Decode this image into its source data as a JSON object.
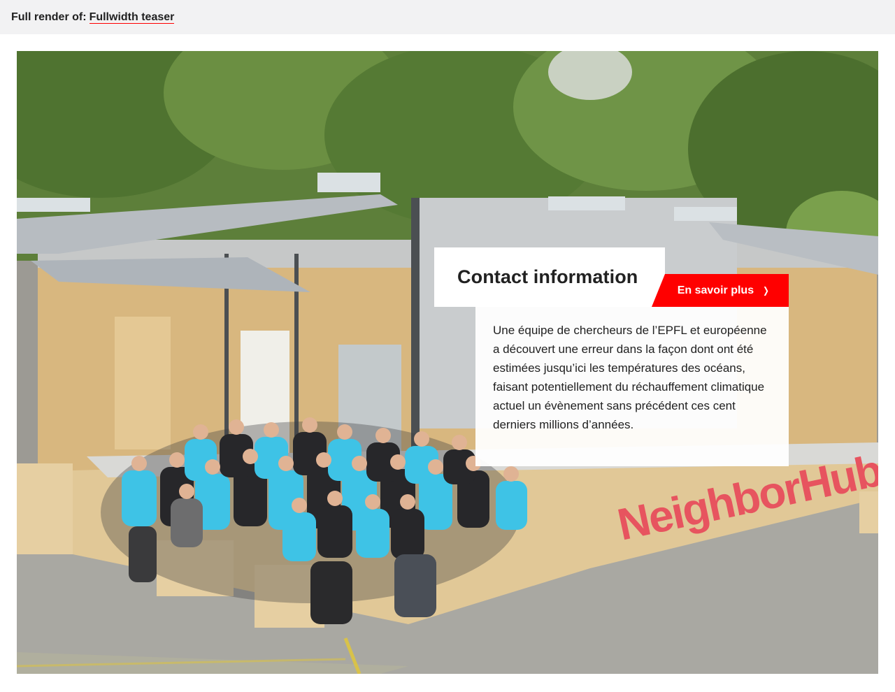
{
  "topbar": {
    "prefix": "Full render of:",
    "link_label": "Fullwidth teaser"
  },
  "teaser": {
    "title": "Contact information",
    "cta_label": "En savoir plus",
    "cta_icon": "chevron-right-icon",
    "body": "Une équipe de chercheurs de l’EPFL et européenne a découvert une erreur dans la façon dont ont été estimées jusqu’ici les températures des océans, faisant potentiellement du réchauffement climatique actuel un évènement sans précédent ces cent derniers millions d’années.",
    "image_sign": "NeighborHub"
  },
  "colors": {
    "accent": "#ff0000",
    "topbar_bg": "#f2f2f3",
    "text": "#212121"
  }
}
